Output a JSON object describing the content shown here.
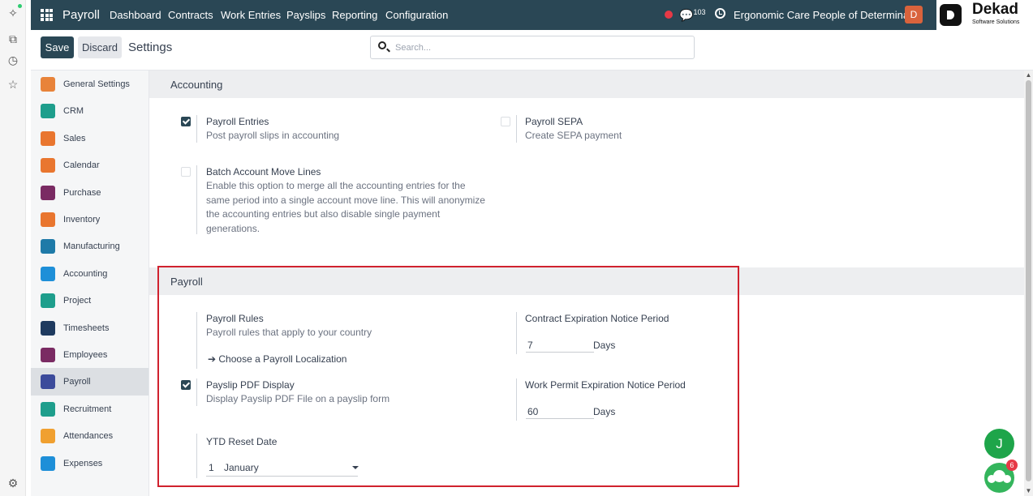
{
  "navbar": {
    "app_name": "Payroll",
    "menu": [
      "Dashboard",
      "Contracts",
      "Work Entries",
      "Payslips",
      "Reporting",
      "Configuration"
    ],
    "chat_count": "103",
    "company": "Ergonomic Care People of Determina...",
    "avatar_letter": "D",
    "logo_name": "Dekad",
    "logo_sub": "Software Solutions"
  },
  "control": {
    "save_label": "Save",
    "discard_label": "Discard",
    "title": "Settings",
    "search_placeholder": "Search..."
  },
  "sidebar": {
    "items": [
      {
        "label": "General Settings",
        "icon": "general-settings-icon",
        "color": "#e8833a"
      },
      {
        "label": "CRM",
        "icon": "crm-icon",
        "color": "#1e9e8c"
      },
      {
        "label": "Sales",
        "icon": "sales-icon",
        "color": "#e9762f"
      },
      {
        "label": "Calendar",
        "icon": "calendar-icon",
        "color": "#e9762f"
      },
      {
        "label": "Purchase",
        "icon": "purchase-icon",
        "color": "#7a2b63"
      },
      {
        "label": "Inventory",
        "icon": "inventory-icon",
        "color": "#e9762f"
      },
      {
        "label": "Manufacturing",
        "icon": "manufacturing-icon",
        "color": "#1e7aa8"
      },
      {
        "label": "Accounting",
        "icon": "accounting-icon",
        "color": "#1e8fd8"
      },
      {
        "label": "Project",
        "icon": "project-icon",
        "color": "#1e9e8c"
      },
      {
        "label": "Timesheets",
        "icon": "timesheets-icon",
        "color": "#1e3a5f"
      },
      {
        "label": "Employees",
        "icon": "employees-icon",
        "color": "#7a2b63"
      },
      {
        "label": "Payroll",
        "icon": "payroll-icon",
        "color": "#3c4b9b"
      },
      {
        "label": "Recruitment",
        "icon": "recruitment-icon",
        "color": "#1e9e8c"
      },
      {
        "label": "Attendances",
        "icon": "attendances-icon",
        "color": "#f0a030"
      },
      {
        "label": "Expenses",
        "icon": "expenses-icon",
        "color": "#1e8fd8"
      }
    ],
    "active": "Payroll"
  },
  "accounting": {
    "header": "Accounting",
    "payroll_entries": {
      "title": "Payroll Entries",
      "desc": "Post payroll slips in accounting",
      "checked": true
    },
    "payroll_sepa": {
      "title": "Payroll SEPA",
      "desc": "Create SEPA payment",
      "checked": false
    },
    "batch": {
      "title": "Batch Account Move Lines",
      "desc_lines": [
        "Enable this option to merge all the accounting entries for the",
        "same period into a single account move line. This will anonymize",
        "the accounting entries but also disable single payment",
        "generations."
      ],
      "checked": false
    }
  },
  "payroll": {
    "header": "Payroll",
    "rules": {
      "title": "Payroll Rules",
      "desc": "Payroll rules that apply to your country",
      "link": "Choose a Payroll Localization"
    },
    "contract_notice": {
      "title": "Contract Expiration Notice Period",
      "value": "7",
      "unit": "Days"
    },
    "pdf_display": {
      "title": "Payslip PDF Display",
      "desc": "Display Payslip PDF File on a payslip form",
      "checked": true
    },
    "work_permit": {
      "title": "Work Permit Expiration Notice Period",
      "value": "60",
      "unit": "Days"
    },
    "ytd": {
      "title": "YTD Reset Date",
      "day": "1",
      "month": "January"
    }
  },
  "floating": {
    "j_letter": "J",
    "badge": "6"
  }
}
